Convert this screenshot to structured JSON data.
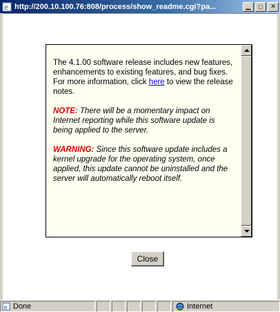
{
  "window": {
    "title": "http://200.10.100.76:808/process/show_readme.cgi?pa...",
    "buttons": [
      "minimize",
      "maximize",
      "close"
    ]
  },
  "readme": {
    "intro_before_link": "The 4.1.00 software release includes new features, enhancements to existing features, and bug fixes. For more information, click ",
    "link_text": "here",
    "intro_after_link": " to view the release notes.",
    "note_label": "NOTE:",
    "note_text": " There will be a momentary impact on Internet reporting while this software update is being applied to the server.",
    "warning_label": "WARNING:",
    "warning_text": " Since this software update includes a kernel upgrade for the operating system, once applied, this update cannot be uninstalled and the server will automatically reboot itself."
  },
  "close_button_label": "Close",
  "status": {
    "text": "Done",
    "zone": "Internet"
  },
  "colors": {
    "panel_bg": "#fffff0",
    "alert_red": "#e00000",
    "link_blue": "#0000ee",
    "titlebar": "#0a246a"
  }
}
